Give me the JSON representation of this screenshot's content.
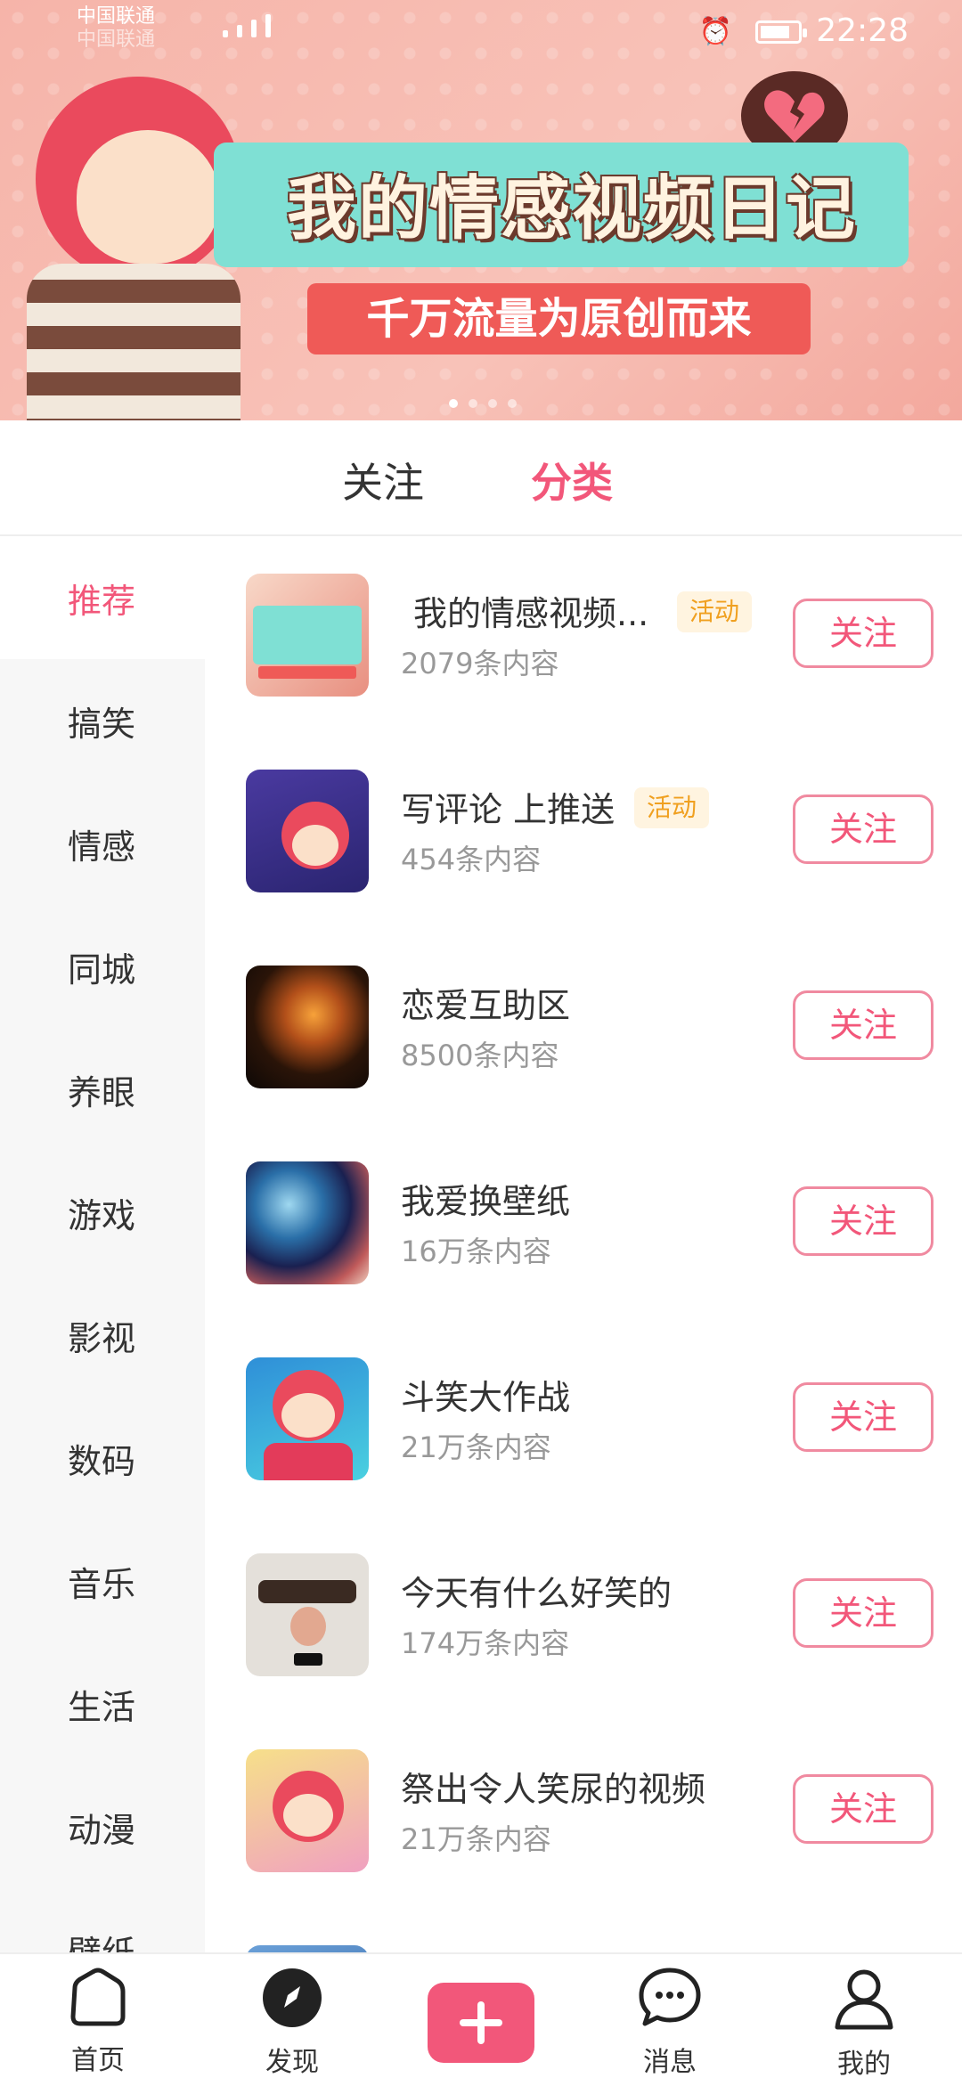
{
  "status_bar": {
    "carrier": "中国联通",
    "time": "22:28"
  },
  "banner": {
    "title": "我的情感视频日记",
    "subtitle": "千万流量为原创而来",
    "dots": 4,
    "active_dot": 0
  },
  "tabs": [
    {
      "label": "关注",
      "active": false
    },
    {
      "label": "分类",
      "active": true
    }
  ],
  "sidebar": {
    "items": [
      {
        "label": "推荐",
        "active": true
      },
      {
        "label": "搞笑",
        "active": false
      },
      {
        "label": "情感",
        "active": false
      },
      {
        "label": "同城",
        "active": false
      },
      {
        "label": "养眼",
        "active": false
      },
      {
        "label": "游戏",
        "active": false
      },
      {
        "label": "影视",
        "active": false
      },
      {
        "label": "数码",
        "active": false
      },
      {
        "label": "音乐",
        "active": false
      },
      {
        "label": "生活",
        "active": false
      },
      {
        "label": "动漫",
        "active": false
      },
      {
        "label": "壁纸",
        "active": false
      }
    ]
  },
  "list": {
    "follow_label": "关注",
    "badge_label": "活动",
    "items": [
      {
        "title": "我的情感视频...",
        "count": "2079条内容",
        "badge": true
      },
      {
        "title": "写评论 上推送",
        "count": "454条内容",
        "badge": true
      },
      {
        "title": "恋爱互助区",
        "count": "8500条内容",
        "badge": false
      },
      {
        "title": "我爱换壁纸",
        "count": "16万条内容",
        "badge": false
      },
      {
        "title": "斗笑大作战",
        "count": "21万条内容",
        "badge": false
      },
      {
        "title": "今天有什么好笑的",
        "count": "174万条内容",
        "badge": false
      },
      {
        "title": "祭出令人笑尿的视频",
        "count": "21万条内容",
        "badge": false
      }
    ]
  },
  "bottom_nav": {
    "home": "首页",
    "discover": "发现",
    "messages": "消息",
    "mine": "我的"
  },
  "colors": {
    "accent": "#f2577a",
    "badge_text": "#f0a020"
  }
}
